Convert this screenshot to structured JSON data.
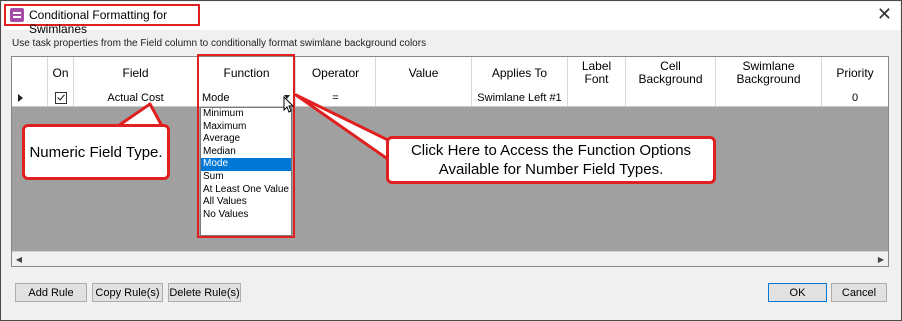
{
  "window": {
    "title": "Conditional Formatting for Swimlanes",
    "close_glyph": "✕",
    "instruction": "Use task properties from the Field column to conditionally format swimlane background colors"
  },
  "grid": {
    "headers": {
      "on": "On",
      "field": "Field",
      "function": "Function",
      "operator": "Operator",
      "value": "Value",
      "applies_to": "Applies To",
      "label_font": "Label Font",
      "cell_background": "Cell Background",
      "swimlane_background": "Swimlane Background",
      "priority": "Priority"
    },
    "row": {
      "field": "Actual Cost",
      "function": "Mode",
      "operator": "=",
      "value": "",
      "applies_to": "Swimlane Left #1",
      "priority": "0"
    }
  },
  "function_options": [
    "Minimum",
    "Maximum",
    "Average",
    "Median",
    "Mode",
    "Sum",
    "At Least One Value",
    "All Values",
    "No Values"
  ],
  "selected_function": "Mode",
  "callouts": {
    "numeric": "Numeric Field Type.",
    "function_help_line1": "Click Here to Access the Function Options",
    "function_help_line2": "Available for Number Field Types."
  },
  "buttons": {
    "add_rule": "Add Rule",
    "copy_rules": "Copy Rule(s)",
    "delete_rules": "Delete Rule(s)",
    "ok": "OK",
    "cancel": "Cancel"
  },
  "colors": {
    "annotation_red": "#e02020",
    "selection_blue": "#0078d7",
    "grid_empty_gray": "#a0a0a0"
  },
  "icons": {
    "app": "conditional-format-icon",
    "close": "close-icon",
    "row_indicator": "row-pointer-icon",
    "dropdown": "chevron-down-icon",
    "cursor": "mouse-pointer-icon"
  }
}
